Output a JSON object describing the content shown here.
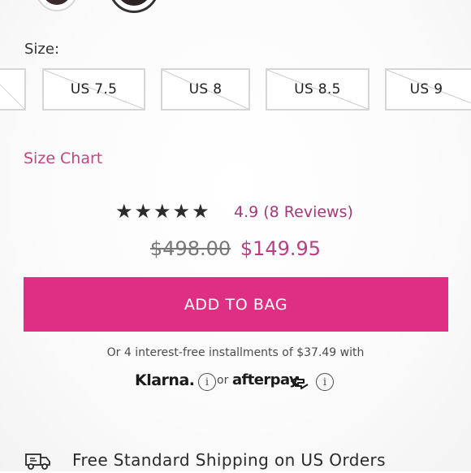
{
  "swatches": [
    {
      "name": "color-swatch",
      "selected": false
    },
    {
      "name": "color-swatch",
      "selected": true
    }
  ],
  "size": {
    "label": "Size:",
    "options": [
      {
        "label": "",
        "unavailable": true
      },
      {
        "label": "US 7.5",
        "unavailable": true
      },
      {
        "label": "US 8",
        "unavailable": true
      },
      {
        "label": "US 8.5",
        "unavailable": true
      },
      {
        "label": "US 9",
        "unavailable": true
      }
    ],
    "chart_link": "Size Chart"
  },
  "rating": {
    "stars": "★★★★★",
    "text": "4.9 (8 Reviews)"
  },
  "price": {
    "original": "$498.00",
    "sale": "$149.95"
  },
  "add_to_bag": "ADD TO BAG",
  "installments": "Or 4 interest-free installments of $37.49 with",
  "bnpl": {
    "klarna": "Klarna.",
    "info_glyph": "i",
    "or": "or",
    "afterpay": "afterpay"
  },
  "shipping": {
    "text": "Free Standard Shipping on US Orders",
    "icon": "truck-icon"
  },
  "colors": {
    "accent_pink": "#df2f84",
    "link_pink": "#c2457e",
    "sale_price": "#b93f80"
  }
}
